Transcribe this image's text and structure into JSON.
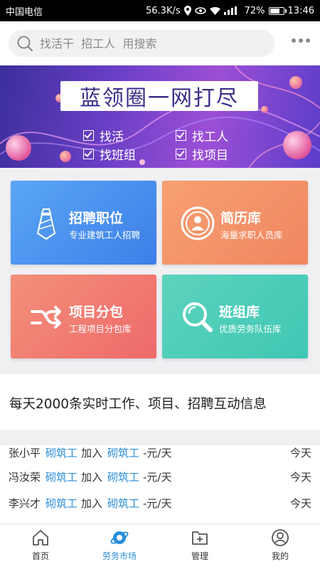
{
  "status_bar": {
    "carrier": "中国电信",
    "speed": "56.3K/s",
    "battery": "72%",
    "time": "13:46"
  },
  "search": {
    "placeholder": "找活干  招工人  用搜索"
  },
  "banner": {
    "title": "蓝领圈一网打尽",
    "items": [
      "找活",
      "找工人",
      "找班组",
      "找项目"
    ]
  },
  "cards": [
    {
      "title": "招聘职位",
      "subtitle": "专业建筑工人招聘",
      "icon": "tie-icon",
      "color": "#4a93f0"
    },
    {
      "title": "简历库",
      "subtitle": "海量求职人员库",
      "icon": "person-badge-icon",
      "color": "#f3936a"
    },
    {
      "title": "项目分包",
      "subtitle": "工程项目分包库",
      "icon": "branch-arrows-icon",
      "color": "#f07b70"
    },
    {
      "title": "班组库",
      "subtitle": "优质劳务队伍库",
      "icon": "magnifier-icon",
      "color": "#4ecdb9"
    }
  ],
  "info": {
    "headline": "每天2000条实时工作、项目、招聘互动信息"
  },
  "feed": [
    {
      "name": "张小平",
      "trade": "砌筑工",
      "join": "加入",
      "trade2": "砌筑工",
      "price": "-元/天",
      "date": "今天"
    },
    {
      "name": "冯汝荣",
      "trade": "砌筑工",
      "join": "加入",
      "trade2": "砌筑工",
      "price": "-元/天",
      "date": "今天"
    },
    {
      "name": "李兴才",
      "trade": "砌筑工",
      "join": "加入",
      "trade2": "砌筑工",
      "price": "-元/天",
      "date": "今天"
    }
  ],
  "tabs": [
    {
      "label": "首页",
      "icon": "home-icon",
      "active": false
    },
    {
      "label": "劳务市场",
      "icon": "planet-icon",
      "active": true
    },
    {
      "label": "管理",
      "icon": "folder-plus-icon",
      "active": false
    },
    {
      "label": "我的",
      "icon": "user-icon",
      "active": false
    }
  ],
  "colors": {
    "accent": "#2a8ed8",
    "banner": "#6a3fc6",
    "background": "#f0f0f3"
  }
}
